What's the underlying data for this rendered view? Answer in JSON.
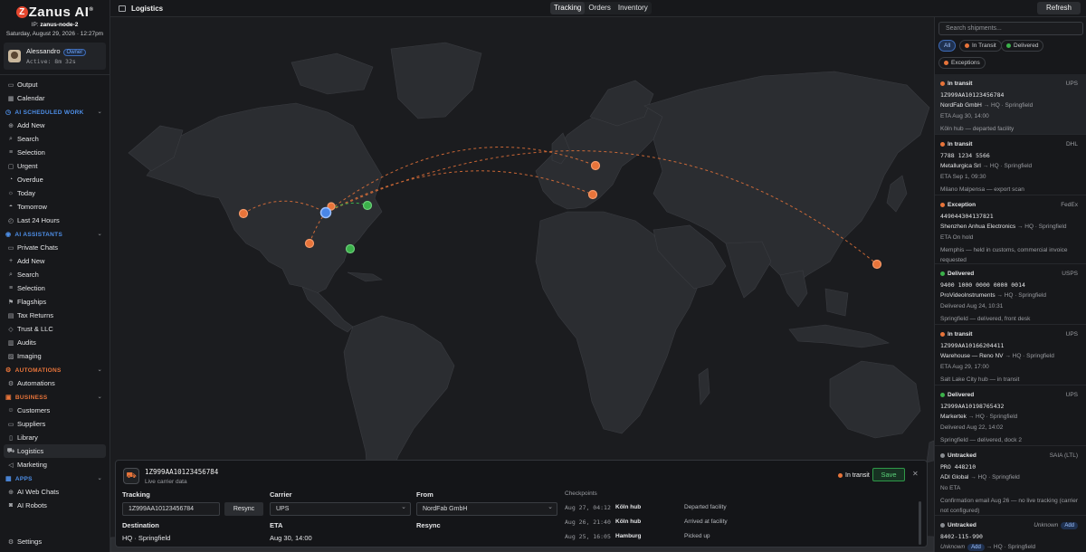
{
  "brand": {
    "name": "Zanus AI",
    "mark": "Z"
  },
  "node": {
    "prefix": "IP:",
    "name": "zanus-node-2"
  },
  "datetime": "Saturday, August 29, 2026 · 12:27pm",
  "user": {
    "name": "Alessandro",
    "badge": "Owner",
    "active": "Active: 8m 32s"
  },
  "nav": {
    "top": [
      {
        "label": "Output",
        "icon": "output-icon"
      },
      {
        "label": "Calendar",
        "icon": "calendar-icon"
      }
    ],
    "sections": [
      {
        "title": "AI SCHEDULED WORK",
        "items": [
          "Add New",
          "Search",
          "Selection",
          "Urgent",
          "Overdue",
          "Today",
          "Tomorrow",
          "Last 24 Hours"
        ]
      },
      {
        "title": "AI ASSISTANTS",
        "items": [
          "Private Chats",
          "Add New",
          "Search",
          "Selection",
          "Flagships",
          "Tax Returns",
          "Trust & LLC",
          "Audits",
          "Imaging"
        ]
      },
      {
        "title": "AUTOMATIONS",
        "items": [
          "Automations"
        ]
      },
      {
        "title": "BUSINESS",
        "items": [
          "Customers",
          "Suppliers",
          "Library",
          "Logistics",
          "Marketing"
        ]
      },
      {
        "title": "APPS",
        "items": [
          "AI Web Chats",
          "AI Robots"
        ]
      }
    ],
    "settings": "Settings"
  },
  "topbar": {
    "title": "Logistics",
    "tabs": [
      "Tracking",
      "Orders",
      "Inventory"
    ],
    "active_tab": "Tracking",
    "refresh": "Refresh"
  },
  "detail": {
    "tracking_number": "1Z999AA10123456784",
    "subtitle": "Live carrier data",
    "status": "In transit",
    "save": "Save",
    "close": "✕",
    "tracking_label": "Tracking",
    "tracking_value": "1Z999AA10123456784",
    "resync_label": "Resync",
    "carrier_label": "Carrier",
    "carrier_value": "UPS",
    "from_label": "From",
    "from_value": "NordFab GmbH",
    "destination_label": "Destination",
    "destination_value": "HQ · Springfield",
    "eta_label": "ETA",
    "eta_value": "Aug 30, 14:00",
    "resync2_label": "Resync",
    "checkpoints_title": "Checkpoints",
    "checkpoints": [
      {
        "date": "Aug 27, 04:12",
        "location": "Köln hub",
        "event": "Departed facility"
      },
      {
        "date": "Aug 26, 21:40",
        "location": "Köln hub",
        "event": "Arrived at facility"
      },
      {
        "date": "Aug 25, 16:05",
        "location": "Hamburg",
        "event": "Picked up"
      }
    ]
  },
  "shipments_panel": {
    "search_placeholder": "Search shipments...",
    "filters": [
      "All",
      "In Transit",
      "Delivered",
      "Exceptions"
    ],
    "items": [
      {
        "status": "In transit",
        "carrier": "UPS",
        "tracking": "1Z999AA10123456784",
        "from": "NordFab GmbH",
        "to": "→ HQ · Springfield",
        "eta": "ETA Aug 30, 14:00",
        "note": "Köln hub — departed facility",
        "color": "#e8743a"
      },
      {
        "status": "In transit",
        "carrier": "DHL",
        "tracking": "7788 1234 5566",
        "from": "Metallurgica Srl",
        "to": "→ HQ · Springfield",
        "eta": "ETA Sep 1, 09:30",
        "note": "Milano Malpensa — export scan",
        "color": "#e8743a"
      },
      {
        "status": "Exception",
        "carrier": "FedEx",
        "tracking": "449044304137821",
        "from": "Shenzhen Anhua Electronics",
        "to": "→ HQ · Springfield",
        "eta": "ETA On hold",
        "note": "Memphis — held in customs, commercial invoice requested",
        "color": "#e8743a"
      },
      {
        "status": "Delivered",
        "carrier": "USPS",
        "tracking": "9400 1000 0000 0000 0014",
        "from": "ProVideoInstruments",
        "to": "→ HQ · Springfield",
        "eta": "Delivered Aug 24, 10:31",
        "note": "Springfield — delivered, front desk",
        "color": "#3bb14a"
      },
      {
        "status": "In transit",
        "carrier": "UPS",
        "tracking": "1Z999AA10166204411",
        "from": "Warehouse — Reno NV",
        "to": "→ HQ · Springfield",
        "eta": "ETA Aug 29, 17:00",
        "note": "Salt Lake City hub — in transit",
        "color": "#e8743a"
      },
      {
        "status": "Delivered",
        "carrier": "UPS",
        "tracking": "1Z999AA10198765432",
        "from": "Markertek",
        "to": "→ HQ · Springfield",
        "eta": "Delivered Aug 22, 14:02",
        "note": "Springfield — delivered, dock 2",
        "color": "#3bb14a"
      },
      {
        "status": "Untracked",
        "carrier": "SAIA (LTL)",
        "tracking": "PRO 448210",
        "from": "ADI Global",
        "to": "→ HQ · Springfield",
        "eta": "No ETA",
        "note": "Confirmation email Aug 26 — no live tracking (carrier not configured)",
        "color": "#8a8d92"
      },
      {
        "status": "Untracked",
        "carrier": "Unknown",
        "tracking": "8402-115-990",
        "from": "Unknown",
        "to": "→ HQ · Springfield",
        "eta": "",
        "note": "",
        "color": "#8a8d92",
        "add": "Add"
      }
    ]
  },
  "map_markers": [
    {
      "name": "hq-marker",
      "color": "#4a86e8"
    },
    {
      "name": "origin-marker",
      "color": "#e8743a"
    },
    {
      "name": "delivered-marker",
      "color": "#3bb14a"
    }
  ]
}
